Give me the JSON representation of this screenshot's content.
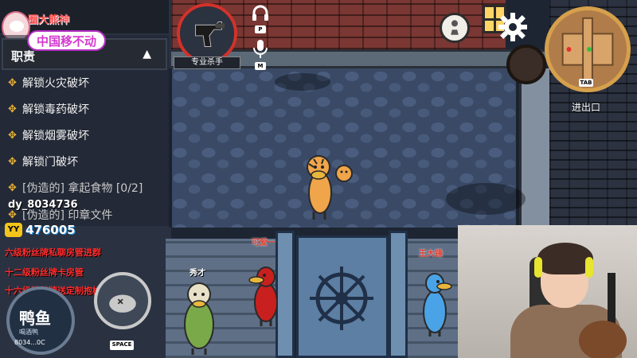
{
  "stream_overlay": {
    "room_tag": "上圈大熊神",
    "channel_title": "中国移不动",
    "douyin_id": "dy_8034736",
    "yy_label": "YY",
    "fan_count": "476005",
    "promo_lines": [
      {
        "text": "六级粉丝牌私聊房管进群",
        "color": "#ff2d2d"
      },
      {
        "text": "十二级粉丝牌卡房管",
        "color": "#ff2d2d"
      },
      {
        "text": "十六级粉丝牌送定制抱枕",
        "color": "#ff2d2d"
      }
    ]
  },
  "mission_panel": {
    "header": "职责",
    "toggle_icon": "▲",
    "tasks": [
      {
        "label": "解锁火灾破坏",
        "fake": false
      },
      {
        "label": "解锁毒药破坏",
        "fake": false
      },
      {
        "label": "解锁烟雾破坏",
        "fake": false
      },
      {
        "label": "解锁门破坏",
        "fake": false
      },
      {
        "label": "[伪造的] 拿起食物 [0/2]",
        "fake": true
      },
      {
        "label": "[伪造的] 印章文件",
        "fake": true
      }
    ]
  },
  "role": {
    "label": "专业杀手",
    "icon": "pistol-icon"
  },
  "controls": {
    "voice_key": "P",
    "mic_key": "M",
    "emote_label": "鸭鱼",
    "emote_sub": "喝酒鸭",
    "emote_id": "8034...0C",
    "attack_key": "SPACE",
    "map_key": "TAB"
  },
  "minimap": {
    "label": "进出口"
  },
  "players": [
    {
      "name": "秀才",
      "color": "#7aa94a"
    },
    {
      "name": "可爱一",
      "color": "#c8201f"
    },
    {
      "name": "王大锤",
      "color": "#4aa3e6"
    }
  ],
  "colors": {
    "role_ring": "#d2322a",
    "minimap_ring": "#d6a04c",
    "player_name": "#e23a2c"
  }
}
